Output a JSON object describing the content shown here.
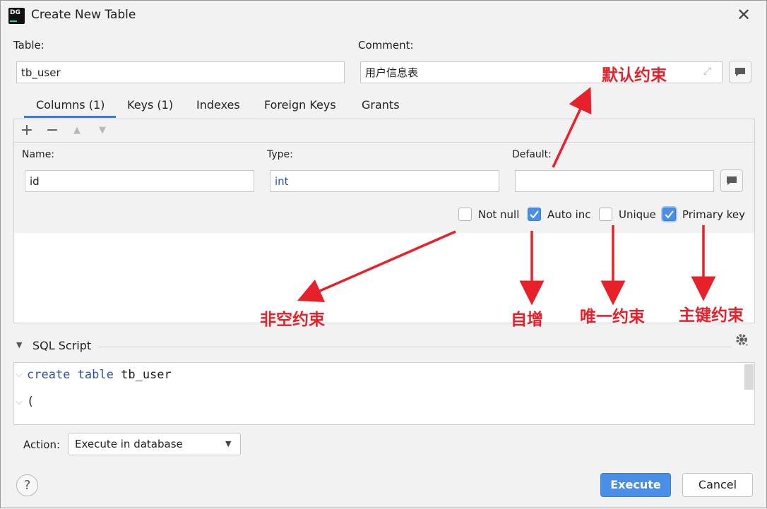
{
  "window": {
    "title": "Create New Table",
    "app_icon_text": "DG"
  },
  "table_section": {
    "table_label": "Table:",
    "table_value": "tb_user",
    "comment_label": "Comment:",
    "comment_value": "用户信息表"
  },
  "tabs": [
    {
      "label": "Columns (1)",
      "active": true
    },
    {
      "label": "Keys (1)",
      "active": false
    },
    {
      "label": "Indexes",
      "active": false
    },
    {
      "label": "Foreign Keys",
      "active": false
    },
    {
      "label": "Grants",
      "active": false
    }
  ],
  "toolbar": {
    "add": "+",
    "remove": "−",
    "up": "▲",
    "down": "▼"
  },
  "column_form": {
    "name_label": "Name:",
    "name_value": "id",
    "type_label": "Type:",
    "type_value": "int",
    "default_label": "Default:",
    "default_value": ""
  },
  "checkboxes": [
    {
      "label": "Not null",
      "checked": false
    },
    {
      "label": "Auto inc",
      "checked": true
    },
    {
      "label": "Unique",
      "checked": false
    },
    {
      "label": "Primary key",
      "checked": true
    }
  ],
  "annotations": {
    "default_constraint": "默认约束",
    "not_null_constraint": "非空约束",
    "auto_increment": "自增",
    "unique_constraint": "唯一约束",
    "primary_key_constraint": "主键约束"
  },
  "sql_script": {
    "header": "SQL Script",
    "line1_kw1": "create",
    "line1_kw2": "table",
    "line1_name": "tb_user",
    "line2": "("
  },
  "action": {
    "label": "Action:",
    "selected": "Execute in database"
  },
  "buttons": {
    "help": "?",
    "execute": "Execute",
    "cancel": "Cancel"
  },
  "colors": {
    "accent": "#4a8ee6",
    "annotation_red": "#e8202a",
    "keyword_blue": "#2c55a6"
  }
}
